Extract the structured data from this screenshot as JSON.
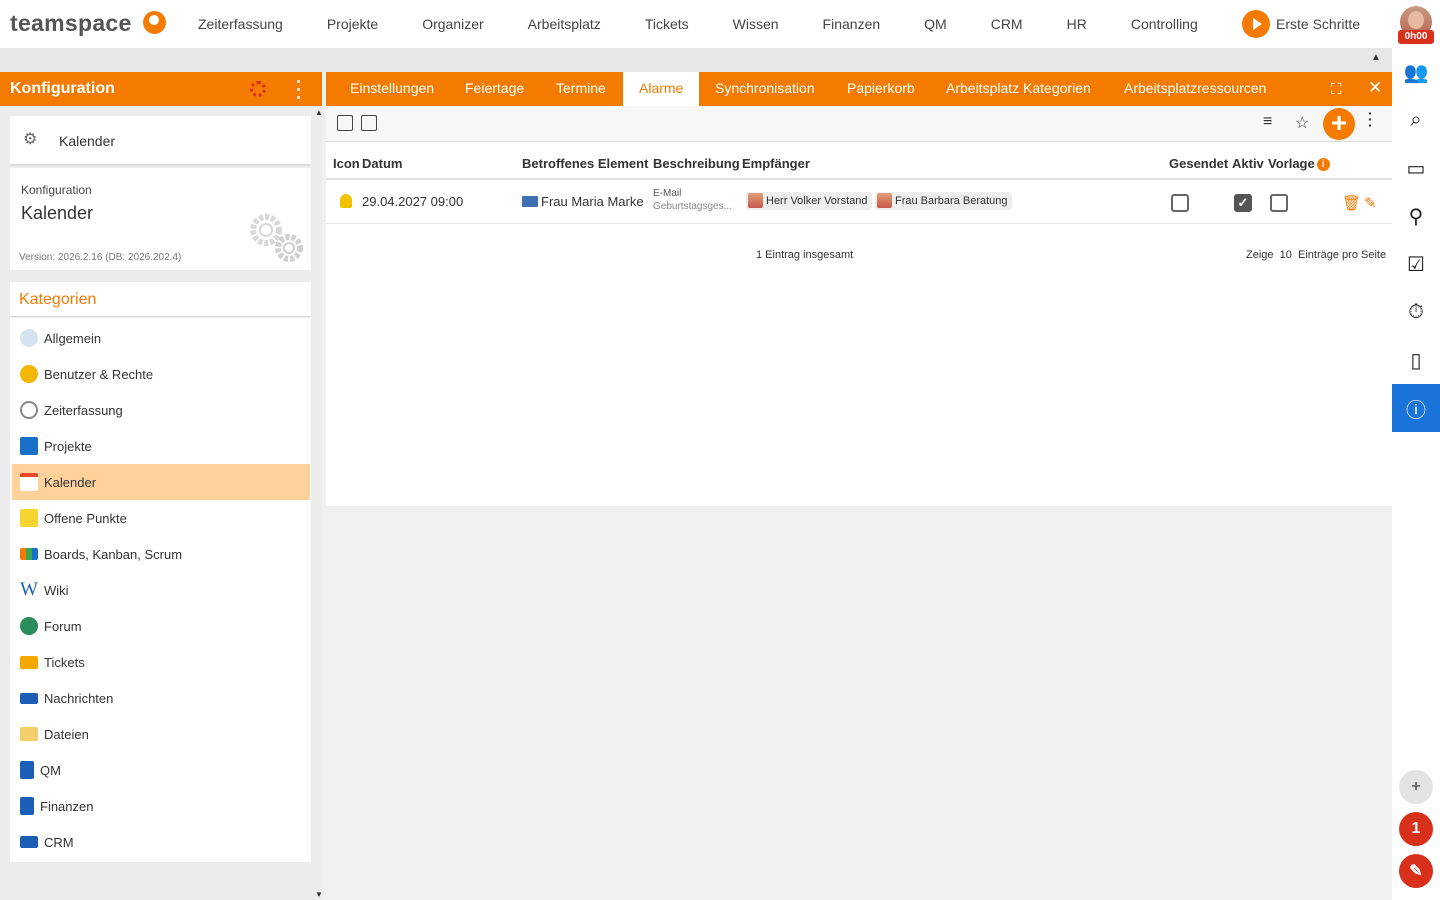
{
  "app": {
    "logo_text": "teamspace",
    "top_nav": [
      "Zeiterfassung",
      "Projekte",
      "Organizer",
      "Arbeitsplatz",
      "Tickets",
      "Wissen",
      "Finanzen",
      "QM",
      "CRM",
      "HR",
      "Controlling"
    ],
    "erste_schritte": "Erste Schritte",
    "time_badge": "0h00",
    "brand_color": "#f47b00"
  },
  "left_panel": {
    "title": "Konfiguration",
    "module_name": "Kalender",
    "info": {
      "label": "Konfiguration",
      "name": "Kalender",
      "version": "Version: 2026.2.16 (DB: 2026.202.4)"
    },
    "categories_title": "Kategorien",
    "categories": [
      {
        "label": "Allgemein",
        "icon": "gears-icon"
      },
      {
        "label": "Benutzer & Rechte",
        "icon": "users-icon"
      },
      {
        "label": "Zeiterfassung",
        "icon": "stopwatch-icon"
      },
      {
        "label": "Projekte",
        "icon": "folder-icon"
      },
      {
        "label": "Kalender",
        "icon": "calendar-icon",
        "active": true
      },
      {
        "label": "Offene Punkte",
        "icon": "note-icon"
      },
      {
        "label": "Boards, Kanban, Scrum",
        "icon": "board-icon"
      },
      {
        "label": "Wiki",
        "icon": "wiki-icon"
      },
      {
        "label": "Forum",
        "icon": "globe-icon"
      },
      {
        "label": "Tickets",
        "icon": "ticket-icon"
      },
      {
        "label": "Nachrichten",
        "icon": "news-icon"
      },
      {
        "label": "Dateien",
        "icon": "files-icon"
      },
      {
        "label": "QM",
        "icon": "qm-icon"
      },
      {
        "label": "Finanzen",
        "icon": "euro-icon"
      },
      {
        "label": "CRM",
        "icon": "crm-icon"
      }
    ]
  },
  "tabs": [
    "Einstellungen",
    "Feiertage",
    "Termine",
    "Alarme",
    "Synchronisation",
    "Papierkorb",
    "Arbeitsplatz Kategorien",
    "Arbeitsplatzressourcen"
  ],
  "active_tab": "Alarme",
  "table": {
    "headers": {
      "icon": "Icon",
      "datum": "Datum",
      "element": "Betroffenes Element",
      "beschreibung": "Beschreibung",
      "empfaenger": "Empfänger",
      "gesendet": "Gesendet",
      "aktiv": "Aktiv",
      "vorlage": "Vorlage"
    },
    "rows": [
      {
        "datum": "29.04.2027 09:00",
        "element": "Frau Maria Marke",
        "beschreibung_line1": "E-Mail",
        "beschreibung_line2": "Geburtstagsges...",
        "empfaenger": [
          "Herr Volker Vorstand",
          "Frau Barbara Beratung"
        ],
        "gesendet": false,
        "aktiv": true,
        "vorlage": false
      }
    ],
    "total_text": "1 Eintrag insgesamt",
    "pager": {
      "show": "Zeige",
      "count": "10",
      "per_page": "Einträge pro Seite"
    }
  },
  "right_sidebar": {
    "notification_count": "1"
  }
}
